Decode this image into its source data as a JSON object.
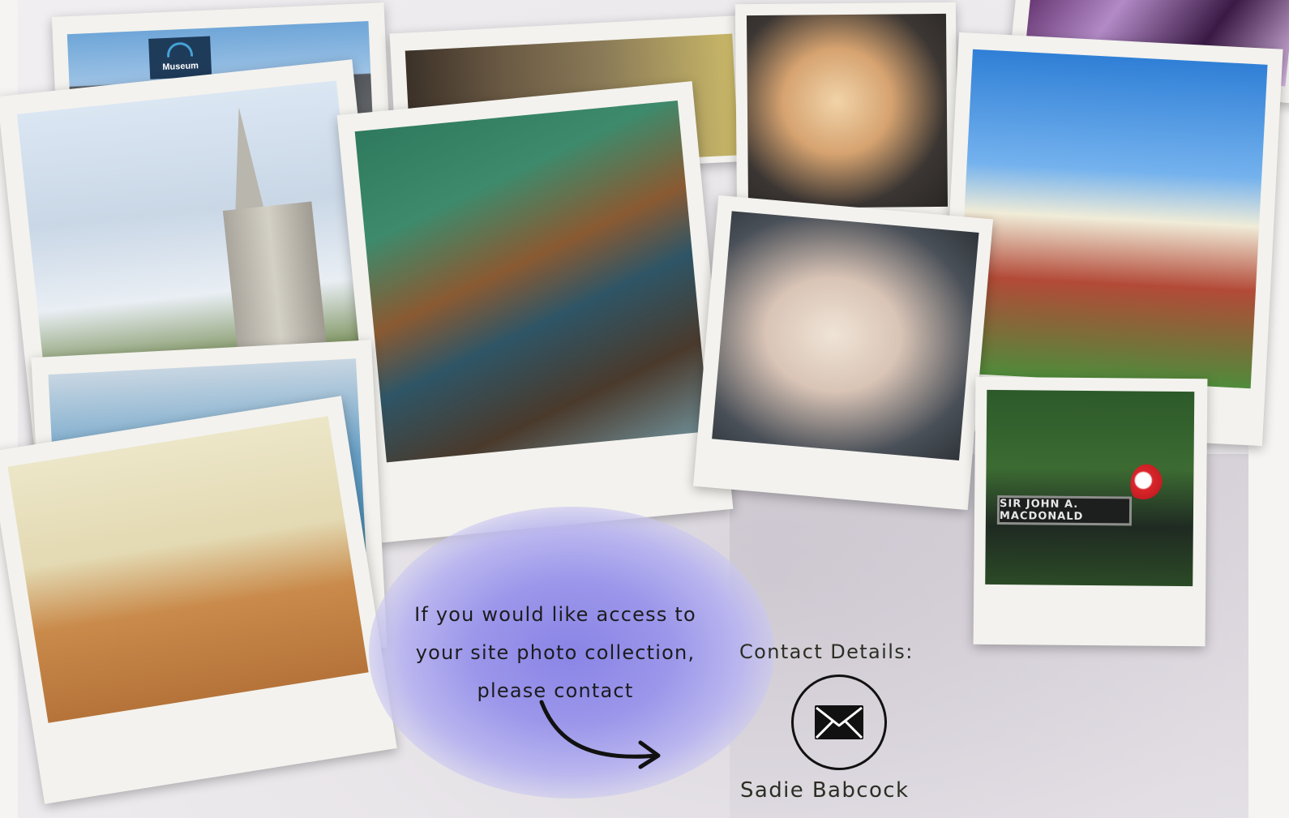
{
  "photos": {
    "museum_sign": "Museum",
    "gate_sign": "SIR JOHN A. MACDONALD"
  },
  "message": {
    "line1": "If you would like access to",
    "line2": "your site photo collection,",
    "line3": "please contact"
  },
  "contact": {
    "title": "Contact Details:",
    "name": "Sadie Babcock",
    "icon": "envelope-icon"
  },
  "colors": {
    "cloud_accent": "#8a84e6",
    "polaroid_frame": "#f3f2ee",
    "text_dark": "#2c2e24"
  }
}
